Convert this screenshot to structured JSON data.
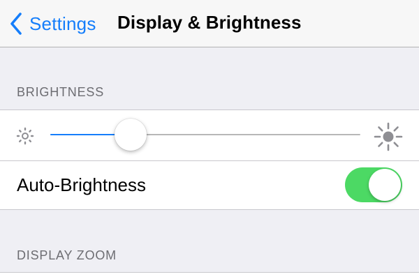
{
  "navbar": {
    "back_label": "Settings",
    "title": "Display & Brightness",
    "back_icon": "chevron-left-icon"
  },
  "sections": {
    "brightness": {
      "header": "BRIGHTNESS",
      "slider": {
        "value": 0.26,
        "min_icon": "sun-small-icon",
        "max_icon": "sun-large-icon"
      },
      "auto_brightness": {
        "label": "Auto-Brightness",
        "enabled": true
      }
    },
    "display_zoom": {
      "header": "DISPLAY ZOOM"
    }
  },
  "colors": {
    "accent": "#157efb",
    "toggle_on": "#4cd964",
    "background": "#efeff4",
    "section_header": "#6d6d72",
    "separator": "#c8c7cc"
  }
}
